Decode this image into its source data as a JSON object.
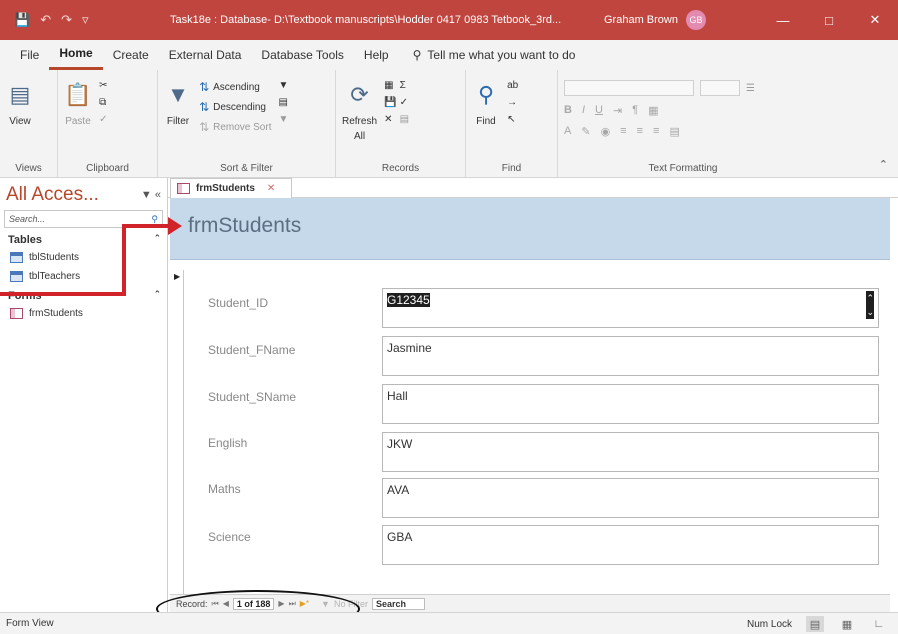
{
  "titlebar": {
    "title": "Task18e : Database- D:\\Textbook manuscripts\\Hodder 0417 0983 Tetbook_3rd...",
    "user_name": "Graham Brown",
    "user_initials": "GB",
    "save_icon": "save-icon",
    "undo_icon": "undo-icon",
    "redo_icon": "redo-icon"
  },
  "menu": {
    "tabs": [
      "File",
      "Home",
      "Create",
      "External Data",
      "Database Tools",
      "Help"
    ],
    "active_tab": "Home",
    "tell_me": "Tell me what you want to do"
  },
  "ribbon": {
    "views": {
      "view_label": "View",
      "group_label": "Views"
    },
    "clipboard": {
      "paste_label": "Paste",
      "group_label": "Clipboard"
    },
    "sort_filter": {
      "filter_label": "Filter",
      "ascending": "Ascending",
      "descending": "Descending",
      "remove_sort": "Remove Sort",
      "group_label": "Sort & Filter"
    },
    "records": {
      "refresh_label": "Refresh",
      "refresh_sub": "All",
      "group_label": "Records"
    },
    "find": {
      "find_label": "Find",
      "group_label": "Find"
    },
    "text_formatting": {
      "group_label": "Text Formatting"
    }
  },
  "nav": {
    "title": "All Acces...",
    "search_placeholder": "Search...",
    "tables_header": "Tables",
    "tables": [
      "tblStudents",
      "tblTeachers"
    ],
    "forms_header": "Forms",
    "forms": [
      "frmStudents"
    ]
  },
  "document": {
    "tab_label": "frmStudents",
    "form_title": "frmStudents"
  },
  "form": {
    "fields": [
      {
        "label": "Student_ID",
        "value": "G12345"
      },
      {
        "label": "Student_FName",
        "value": "Jasmine"
      },
      {
        "label": "Student_SName",
        "value": "Hall"
      },
      {
        "label": "English",
        "value": "JKW"
      },
      {
        "label": "Maths",
        "value": "AVA"
      },
      {
        "label": "Science",
        "value": "GBA"
      }
    ]
  },
  "record_nav": {
    "record_label": "Record:",
    "position": "1 of 188",
    "no_filter": "No Filter",
    "search": "Search"
  },
  "status": {
    "mode": "Form View",
    "num_lock": "Num Lock"
  },
  "colors": {
    "title_bar": "#c0453f",
    "accent": "#b7472a",
    "form_header": "#c6d9ea",
    "callout": "#d0232a"
  }
}
